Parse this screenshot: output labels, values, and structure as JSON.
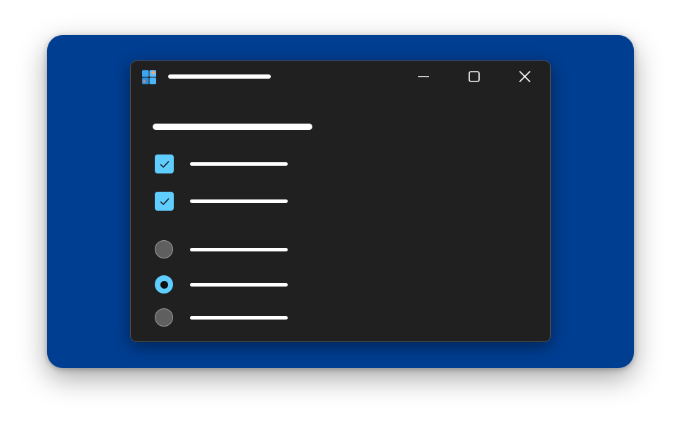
{
  "window": {
    "title_placeholder": "",
    "caption_buttons": {
      "minimize": "minimize-icon",
      "maximize": "maximize-icon",
      "close": "close-icon"
    }
  },
  "content": {
    "heading_placeholder": "",
    "checkboxes": [
      {
        "label": "",
        "checked": true
      },
      {
        "label": "",
        "checked": true
      }
    ],
    "radios": [
      {
        "label": "",
        "selected": false
      },
      {
        "label": "",
        "selected": true
      },
      {
        "label": "",
        "selected": false
      }
    ]
  },
  "colors": {
    "backdrop": "#003e92",
    "window_bg": "#202020",
    "accent": "#60cdff",
    "radio_off": "#5f5f5f",
    "text_line": "#ffffff"
  }
}
